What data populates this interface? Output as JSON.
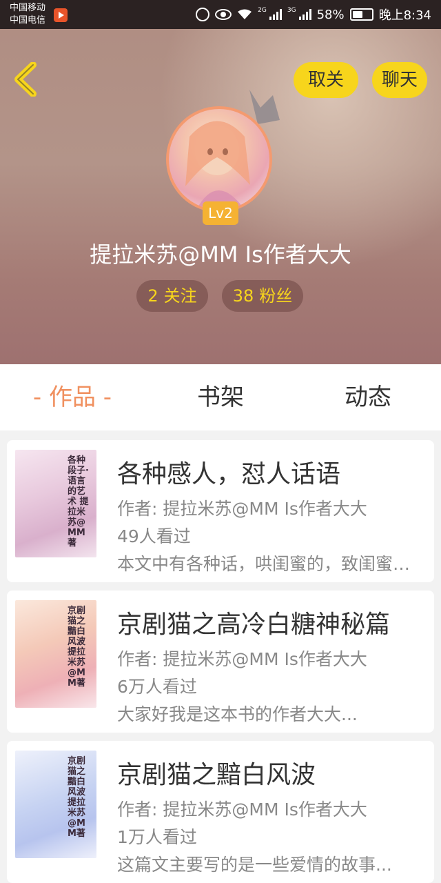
{
  "status_bar": {
    "carrier1": "中国移动",
    "carrier2": "中国电信",
    "net1": "2G",
    "net2": "3G",
    "battery": "58%",
    "time": "晚上8:34"
  },
  "header": {
    "unfollow_label": "取关",
    "chat_label": "聊天",
    "level": "Lv2",
    "username": "提拉米苏@MM Is作者大大",
    "following_count": "2",
    "following_label": "关注",
    "fans_count": "38",
    "fans_label": "粉丝",
    "accent_color": "#f7d51c"
  },
  "tabs": [
    {
      "label": "- 作品 -",
      "active": true
    },
    {
      "label": "书架",
      "active": false
    },
    {
      "label": "动态",
      "active": false
    }
  ],
  "books": [
    {
      "title": "各种感人，怼人话语",
      "author": "作者: 提拉米苏@MM Is作者大大",
      "views": "49人看过",
      "description": "本文中有各种话，哄闺蜜的，致闺蜜的...",
      "cover_text": "各种段子·语言的艺术 提拉米苏@MM著"
    },
    {
      "title": "京剧猫之高冷白糖神秘篇",
      "author": "作者: 提拉米苏@MM Is作者大大",
      "views": "6万人看过",
      "description": "大家好我是这本书的作者大大...",
      "cover_text": "京剧猫之黯白风波 提拉米苏@MM著"
    },
    {
      "title": "京剧猫之黯白风波",
      "author": "作者: 提拉米苏@MM Is作者大大",
      "views": "1万人看过",
      "description": "这篇文主要写的是一些爱情的故事...",
      "cover_text": "京剧猫之黯白风波 提拉米苏@MM著"
    }
  ]
}
